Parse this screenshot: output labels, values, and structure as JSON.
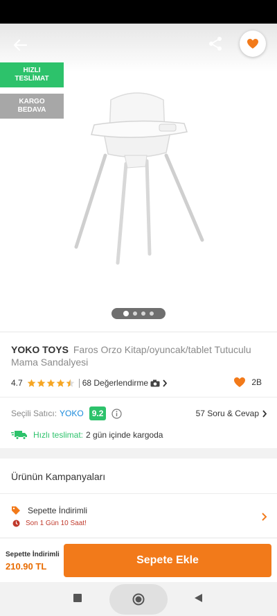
{
  "hero": {
    "badges": {
      "fast_line1": "HIZLI",
      "fast_line2": "TESLİMAT",
      "cargo_line1": "KARGO",
      "cargo_line2": "BEDAVA"
    },
    "image_icon": "high-chair-product-image",
    "carousel_dots": 4,
    "carousel_active_index": 0
  },
  "product": {
    "brand": "YOKO TOYS",
    "name": "Faros Orzo Kitap/oyuncak/tablet Tutuculu Mama Sandalyesi",
    "rating": "4.7",
    "stars": 4.5,
    "reviews": "68 Değerlendirme",
    "favorite_count": "2B"
  },
  "seller": {
    "label": "Seçili Satıcı:",
    "name": "YOKO",
    "score": "9.2",
    "qa": "57 Soru & Cevap"
  },
  "delivery": {
    "label": "Hızlı teslimat:",
    "text": "2 gün içinde kargoda"
  },
  "campaigns": {
    "title": "Ürünün Kampanyaları",
    "item_name": "Sepette İndirimli",
    "item_timer": "Son 1 Gün 10 Saat!"
  },
  "footer": {
    "price_label": "Sepette İndirimli",
    "price": "210.90 TL",
    "add_button": "Sepete Ekle"
  },
  "colors": {
    "accent": "#f27a1a",
    "green": "#2dc26b",
    "seller_blue": "#1a8adc",
    "star": "#f6a623"
  }
}
